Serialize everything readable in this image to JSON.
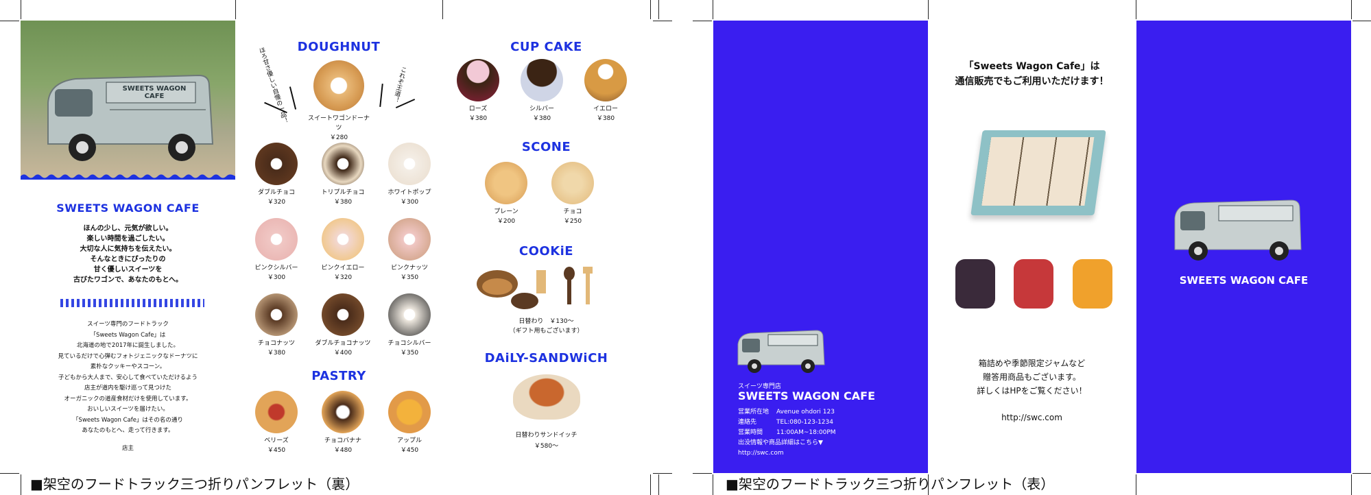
{
  "back": {
    "caption": "■架空のフードトラック三つ折りパンフレット（裏）",
    "truck_sign": "SWEETS WAGON CAFE",
    "brand": "SWEETS WAGON CAFE",
    "tagline": [
      "ほんの少し、元気が欲しい。",
      "楽しい時間を過ごしたい。",
      "大切な人に気持ちを伝えたい。",
      "そんなときにぴったりの",
      "甘く優しいスイーツを",
      "古びたワゴンで、あなたのもとへ。"
    ],
    "story": [
      "スイーツ専門のフードトラック",
      "「Sweets Wagon Cafe」は",
      "北海道の地で2017年に誕生しました。",
      "見ているだけで心弾むフォトジェニックなドーナツに",
      "素朴なクッキーやスコーン。",
      "子どもから大人まで、安心して食べていただけるよう",
      "店主が道内を駆け巡って見つけた",
      "オーガニックの道産食材だけを使用しています。",
      "おいしいスイーツを届けたい。",
      "「Sweets Wagon Cafe」はその名の通り",
      "あなたのもとへ、走って行きます。"
    ],
    "signature": "店主",
    "doughnut_title": "DOUGHNUT",
    "featured": {
      "name": "スイートワゴンドーナツ",
      "price": "￥280",
      "note_left": "ほろ甘さ優しい自慢の一品！",
      "note_right": "これぞ王道！"
    },
    "doughnuts": [
      {
        "name": "ダブルチョコ",
        "price": "￥320"
      },
      {
        "name": "トリプルチョコ",
        "price": "￥380"
      },
      {
        "name": "ホワイトポップ",
        "price": "￥300"
      },
      {
        "name": "ピンクシルバー",
        "price": "￥300"
      },
      {
        "name": "ピンクイエロー",
        "price": "￥320"
      },
      {
        "name": "ピンクナッツ",
        "price": "￥350"
      },
      {
        "name": "チョコナッツ",
        "price": "￥380"
      },
      {
        "name": "ダブルチョコナッツ",
        "price": "￥400"
      },
      {
        "name": "チョコシルバー",
        "price": "￥350"
      }
    ],
    "pastry_title": "PASTRY",
    "pastries": [
      {
        "name": "ベリーズ",
        "price": "￥450"
      },
      {
        "name": "チョコバナナ",
        "price": "￥480"
      },
      {
        "name": "アップル",
        "price": "￥450"
      }
    ],
    "cupcake_title": "CUP CAKE",
    "cupcakes": [
      {
        "name": "ローズ",
        "price": "￥380"
      },
      {
        "name": "シルバー",
        "price": "￥380"
      },
      {
        "name": "イエロー",
        "price": "￥380"
      }
    ],
    "scone_title": "SCONE",
    "scones": [
      {
        "name": "プレーン",
        "price": "￥200"
      },
      {
        "name": "チョコ",
        "price": "￥250"
      }
    ],
    "cookie_title": "COOKiE",
    "cookie_name": "日替わり　￥130～",
    "cookie_note": "（ギフト用もございます）",
    "sandwich_title": "DAiLY-SANDWiCH",
    "sandwich_name": "日替わりサンドイッチ",
    "sandwich_price": "￥580～"
  },
  "front": {
    "caption": "■架空のフードトラック三つ折りパンフレット（表）",
    "small_label": "スイーツ専門店",
    "brand": "SWEETS WAGON CAFE",
    "info": [
      {
        "k": "営業所在地",
        "v": "Avenue ohdori 123"
      },
      {
        "k": "連絡先",
        "v": "TEL:080-123-1234"
      },
      {
        "k": "営業時間",
        "v": "11:00AM~18:00PM"
      },
      {
        "k": "出没情報や商品詳細はこちら▼",
        "v": ""
      },
      {
        "k": "http://swc.com",
        "v": ""
      }
    ],
    "mail_head": [
      "「Sweets Wagon Cafe」は",
      "通信販売でもご利用いただけます！"
    ],
    "gift_text": [
      "箱詰めや季節限定ジャムなど",
      "贈答用商品もございます。",
      "詳しくはHPをご覧ください！"
    ],
    "url": "http://swc.com",
    "cover_brand": "SWEETS WAGON CAFE"
  },
  "colors": {
    "accent": "#1d32e0",
    "panel_blue": "#3a1ef0"
  }
}
